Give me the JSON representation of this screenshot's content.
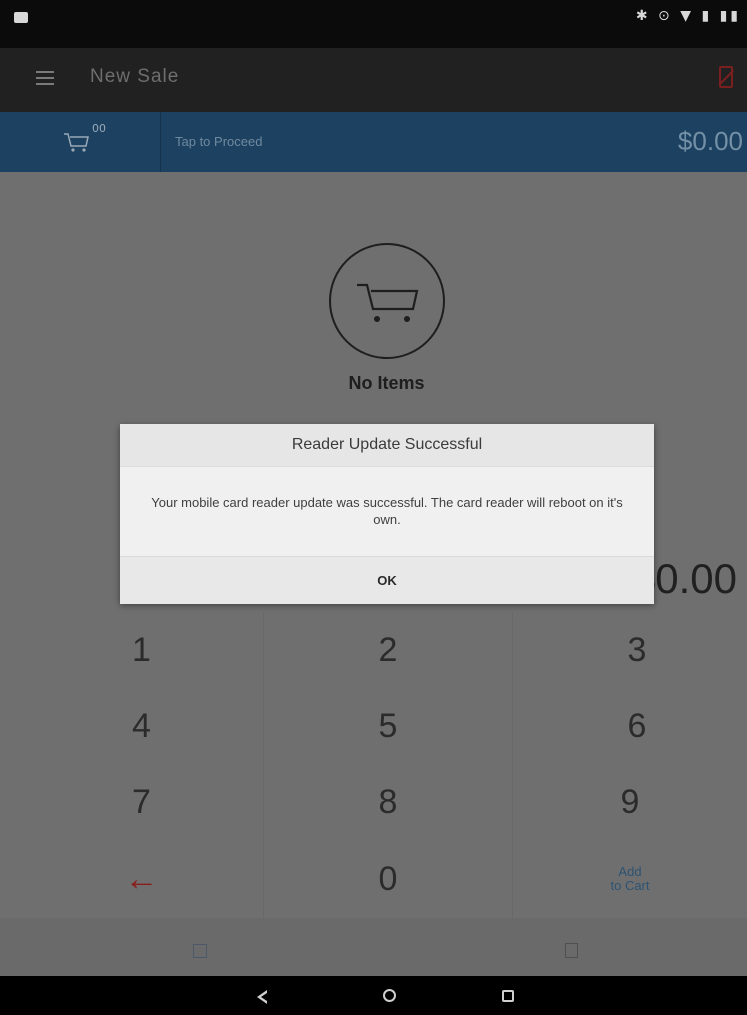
{
  "status_bar": {
    "right_icons": "✱ ⊙ ▼ ▮ ▮▮"
  },
  "app_bar": {
    "title": "New Sale"
  },
  "cart_bar": {
    "proceed_label": "Tap to Proceed",
    "total": "$0.00",
    "badge": "00"
  },
  "empty_state": {
    "label": "No Items"
  },
  "amount_display": {
    "value": "$0.00"
  },
  "keypad": {
    "keys": [
      "1",
      "2",
      "3",
      "4",
      "5",
      "6",
      "7",
      "8",
      "9",
      "←",
      "0"
    ],
    "add_to_cart_line1": "Add",
    "add_to_cart_line2": "to Cart"
  },
  "dialog": {
    "title": "Reader Update Successful",
    "message": "Your mobile card reader update was successful. The card reader will reboot on it's own.",
    "ok_label": "OK"
  },
  "colors": {
    "status_bar": "#0b0b0b",
    "app_bar": "#212121",
    "cart_bar": "#1d4160",
    "overlay_bg": "#6f6f6f",
    "dialog_bg": "#f0f0f0",
    "backspace": "#8a1c1c"
  }
}
